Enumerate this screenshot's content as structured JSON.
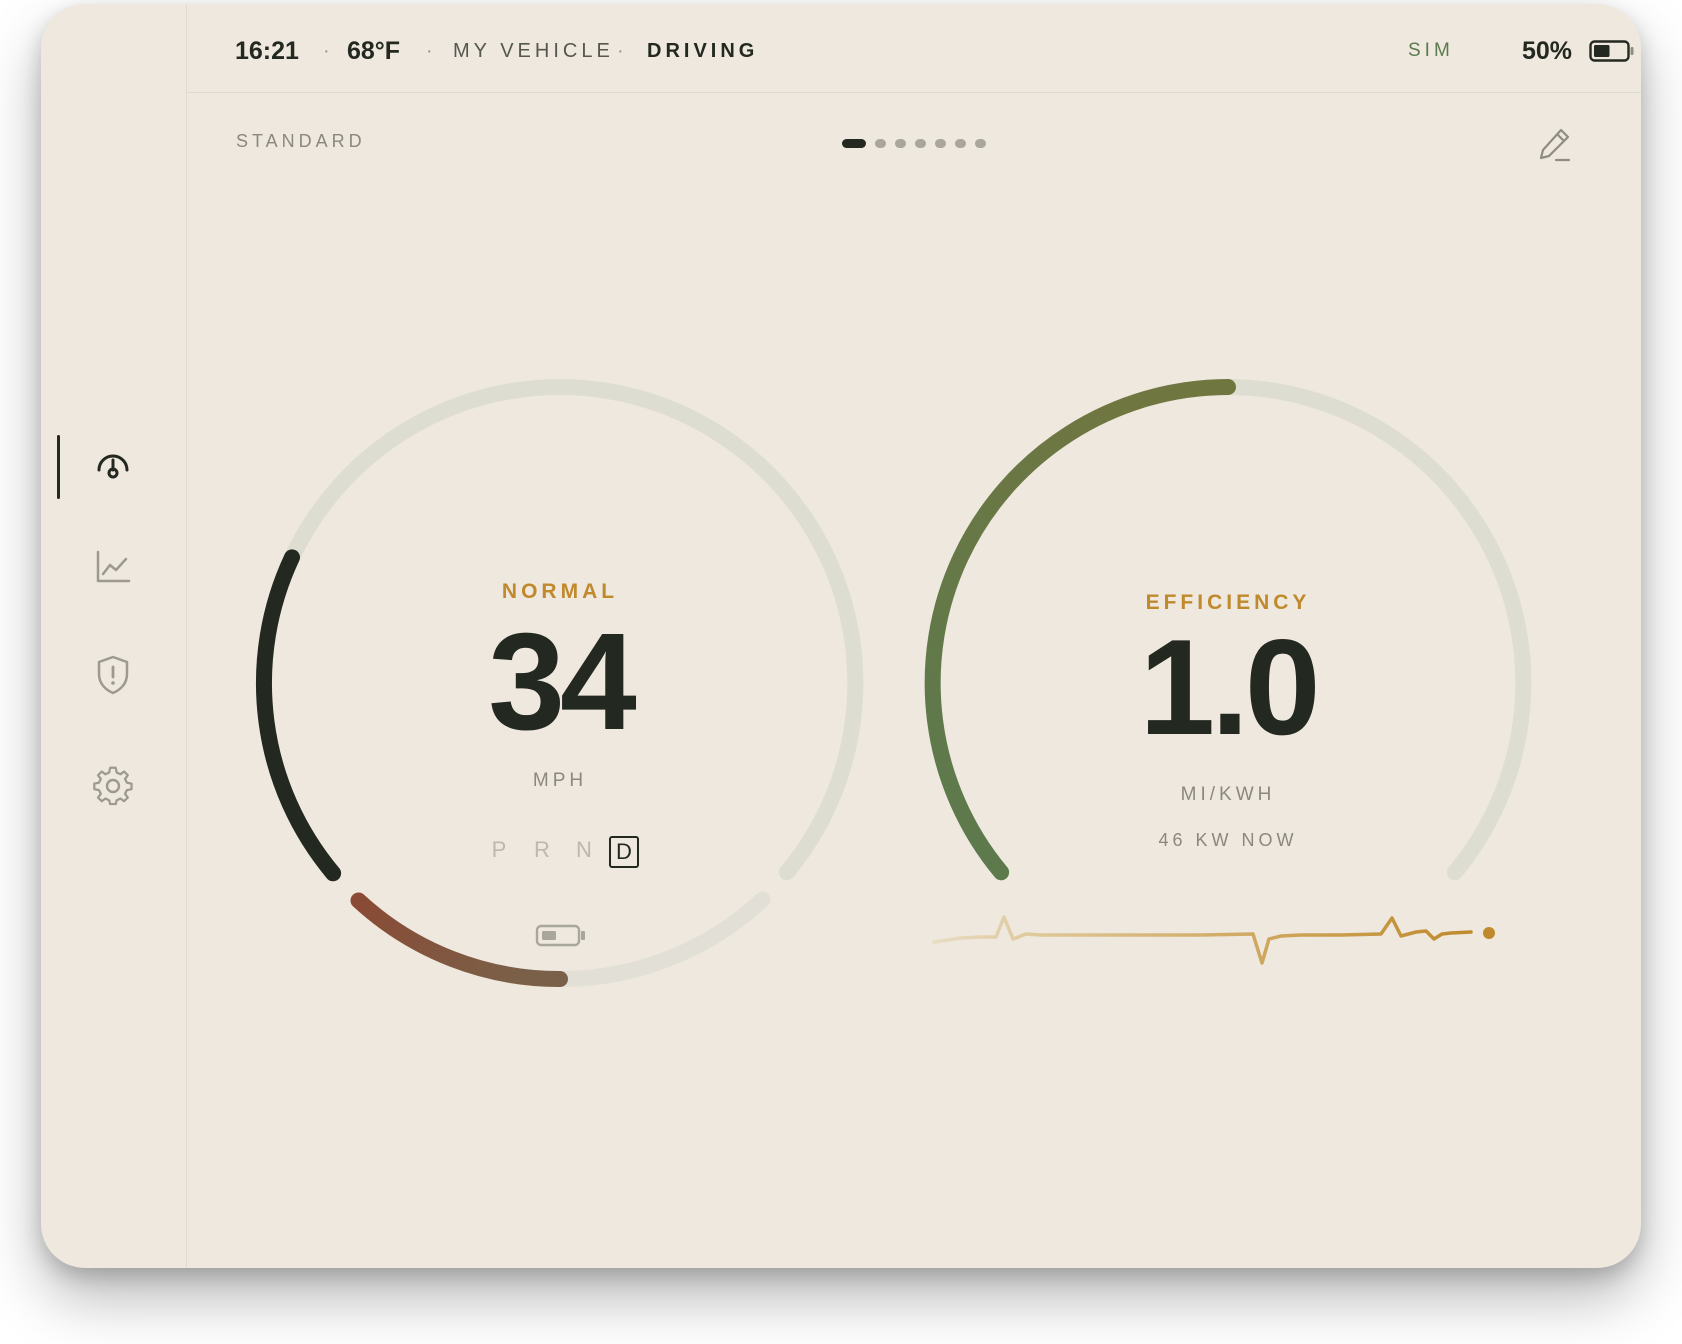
{
  "status_bar": {
    "time": "16:21",
    "temperature": "68°F",
    "vehicle_name": "MY VEHICLE",
    "drive_state": "DRIVING",
    "connectivity": "SIM",
    "battery_percent": "50%",
    "battery_level": 0.5,
    "separator": "·"
  },
  "sidebar": {
    "items": [
      {
        "name": "gauge",
        "icon": "gauge-icon",
        "active": true
      },
      {
        "name": "trends",
        "icon": "line-chart-icon",
        "active": false
      },
      {
        "name": "alerts",
        "icon": "shield-alert-icon",
        "active": false
      },
      {
        "name": "settings",
        "icon": "gear-icon",
        "active": false
      }
    ]
  },
  "layout_label": "STANDARD",
  "pager": {
    "count": 7,
    "active_index": 0
  },
  "speed_gauge": {
    "mode": "NORMAL",
    "value": "34",
    "unit": "MPH",
    "gears": [
      "P",
      "R",
      "N",
      "D"
    ],
    "active_gear": "D",
    "battery_icon": "battery-icon"
  },
  "efficiency_gauge": {
    "label": "EFFICIENCY",
    "value": "1.0",
    "unit": "MI/KWH",
    "power_readout": "46 KW NOW"
  },
  "colors": {
    "background": "#eee8de",
    "ink": "#232820",
    "accent_gold": "#c08a2c",
    "regen_red": "#8a4a35",
    "efficiency_green": "#5b7a4e",
    "efficiency_olive": "#707640",
    "track": "#dedcd0"
  }
}
